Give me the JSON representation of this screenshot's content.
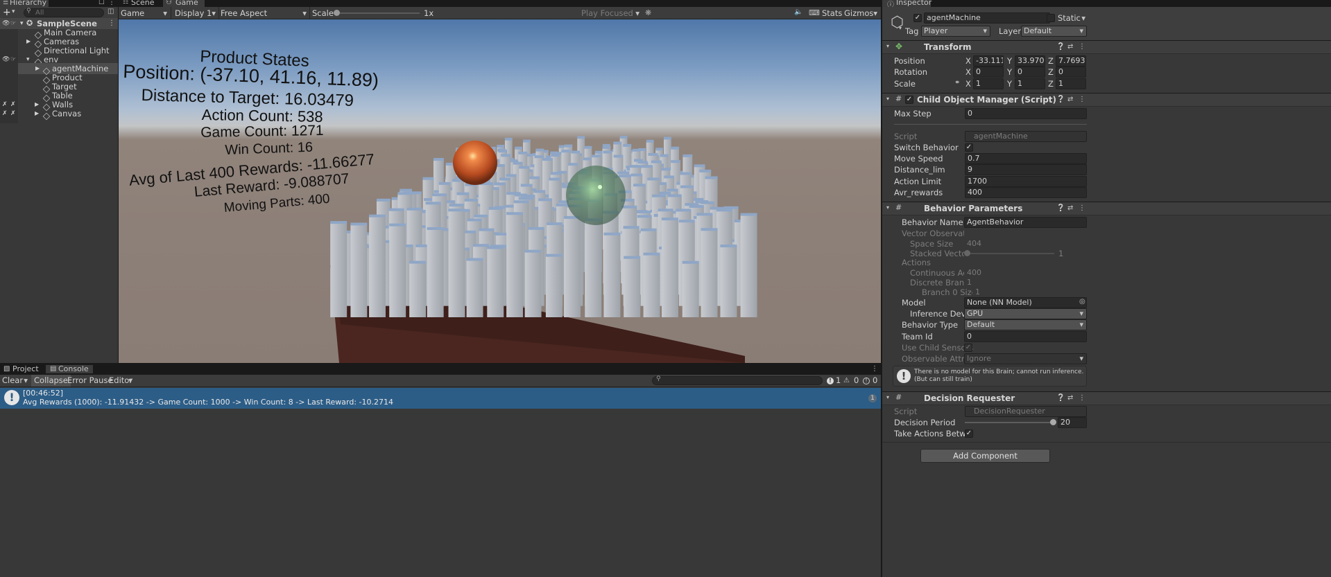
{
  "hierarchy": {
    "tab": "Hierarchy",
    "search_placeholder": "All",
    "scene": "SampleScene",
    "items": [
      {
        "label": "Main Camera"
      },
      {
        "label": "Cameras"
      },
      {
        "label": "Directional Light"
      },
      {
        "label": "env"
      },
      {
        "label": "agentMachine"
      },
      {
        "label": "Product"
      },
      {
        "label": "Target"
      },
      {
        "label": "Table"
      },
      {
        "label": "Walls"
      },
      {
        "label": "Canvas"
      }
    ]
  },
  "center_tabs": {
    "scene": "Scene",
    "game": "Game"
  },
  "game_toolbar": {
    "mode": "Game",
    "display": "Display 1",
    "aspect": "Free Aspect",
    "scale_label": "Scale",
    "scale_value": "1x",
    "play_focused": "Play Focused",
    "stats": "Stats",
    "gizmos": "Gizmos"
  },
  "hud": {
    "title": "Product States",
    "position": "Position: (-37.10, 41.16, 11.89)",
    "distance": "Distance to Target: 16.03479",
    "action_count": "Action Count: 538",
    "game_count": "Game Count: 1271",
    "win_count": "Win Count: 16",
    "avg_rewards": "Avg of Last 400 Rewards: -11.66277",
    "last_reward": "Last Reward: -9.088707",
    "moving_parts": "Moving Parts: 400"
  },
  "console": {
    "tab_project": "Project",
    "tab_console": "Console",
    "clear": "Clear",
    "collapse": "Collapse",
    "error_pause": "Error Pause",
    "editor": "Editor",
    "count_info": "1",
    "count_warn": "0",
    "count_error": "0",
    "log_time": "[00:46:52]",
    "log_message": "Avg Rewards (1000): -11.91432 -> Game Count: 1000 -> Win Count: 8 -> Last Reward: -10.2714",
    "log_count": "1"
  },
  "inspector": {
    "tab": "Inspector",
    "object_name": "agentMachine",
    "static_label": "Static",
    "tag_label": "Tag",
    "tag_value": "Player",
    "layer_label": "Layer",
    "layer_value": "Default",
    "transform": {
      "title": "Transform",
      "position_label": "Position",
      "rotation_label": "Rotation",
      "scale_label": "Scale",
      "pos": {
        "x": "-33.1116",
        "y": "33.9702",
        "z": "7.76933"
      },
      "rot": {
        "x": "0",
        "y": "0",
        "z": "0"
      },
      "scl": {
        "x": "1",
        "y": "1",
        "z": "1"
      },
      "x": "X",
      "y": "Y",
      "z": "Z"
    },
    "com": {
      "title": "Child Object Manager (Script)",
      "max_step_label": "Max Step",
      "max_step": "0",
      "script_label": "Script",
      "script": "agentMachine",
      "switch_label": "Switch Behavior",
      "move_speed_label": "Move Speed",
      "move_speed": "0.7",
      "distance_label": "Distance_lim",
      "distance": "9",
      "action_limit_label": "Action Limit",
      "action_limit": "1700",
      "avr_label": "Avr_rewards",
      "avr": "400"
    },
    "bp": {
      "title": "Behavior Parameters",
      "behavior_name_label": "Behavior Name",
      "behavior_name": "AgentBehavior",
      "vector_obs": "Vector Observation",
      "space_size_label": "Space Size",
      "space_size": "404",
      "stacked_label": "Stacked Vectors",
      "stacked": "1",
      "actions": "Actions",
      "continuous_label": "Continuous Actic",
      "continuous": "400",
      "discrete_label": "Discrete Branche",
      "discrete": "1",
      "branch0_label": "Branch 0 Size",
      "branch0": "1",
      "model_label": "Model",
      "model": "None (NN Model)",
      "device_label": "Inference Device",
      "device": "GPU",
      "type_label": "Behavior Type",
      "type": "Default",
      "team_label": "Team Id",
      "team": "0",
      "child_sensors_label": "Use Child Sensors",
      "observable_label": "Observable Attribut",
      "observable": "Ignore",
      "warning": "There is no model for this Brain; cannot run inference. (But can still train)"
    },
    "dr": {
      "title": "Decision Requester",
      "script_label": "Script",
      "script": "DecisionRequester",
      "period_label": "Decision Period",
      "period": "20",
      "take_label": "Take Actions Betweer"
    },
    "add_component": "Add Component"
  }
}
